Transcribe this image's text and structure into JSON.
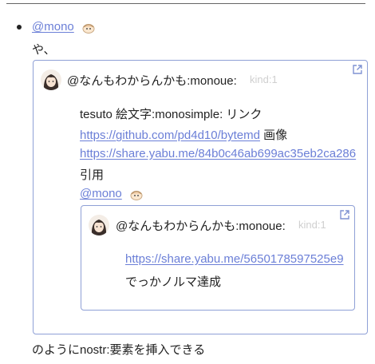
{
  "post": {
    "mention": "@mono",
    "line2": "や、",
    "footer": "のようにnostr:要素を挿入できる"
  },
  "outer_card": {
    "author": "@なんもわからんかも:monoue:",
    "kind": "kind:1",
    "body_line1": "tesuto 絵文字:monosimple: リンク",
    "link1": "https://github.com/pd4d10/bytemd",
    "link1_suffix": "画像",
    "link2": "https://share.yabu.me/84b0c46ab699ac35eb2ca286",
    "quote_label": "引用",
    "mention": "@mono"
  },
  "inner_card": {
    "author": "@なんもわからんかも:monoue:",
    "kind": "kind:1",
    "link": "https://share.yabu.me/5650178597525e9",
    "text": "でっかノルマ達成"
  },
  "icons": {
    "mention_emoji": "custom-emoji-icon",
    "open_external": "external-link-icon",
    "avatar": "user-avatar"
  },
  "colors": {
    "link": "#6b7fd7",
    "card_border": "#8fa0d6",
    "faint_text": "#cfcfcf"
  }
}
